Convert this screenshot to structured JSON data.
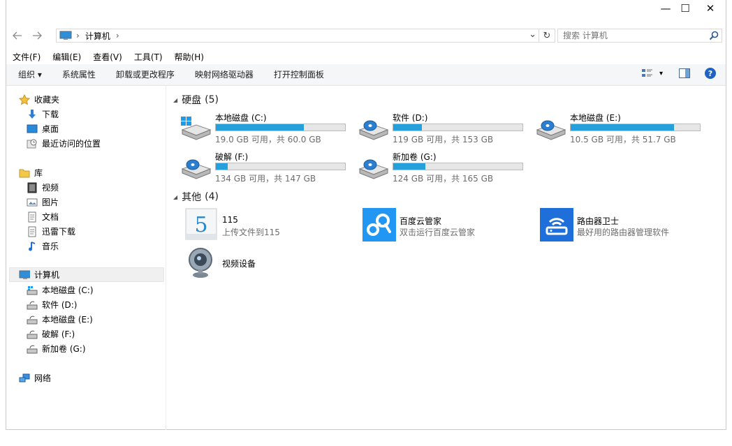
{
  "window": {
    "minimize": "—",
    "maximize": "☐",
    "close": "✕"
  },
  "address": {
    "path": "计算机",
    "sep1": "›",
    "sep2": "›",
    "dropdown": "⌄",
    "refresh": "↻"
  },
  "search": {
    "placeholder": "搜索 计算机"
  },
  "menubar": [
    "文件(F)",
    "编辑(E)",
    "查看(V)",
    "工具(T)",
    "帮助(H)"
  ],
  "toolbar": {
    "organize": "组织 ▾",
    "items": [
      "系统属性",
      "卸载或更改程序",
      "映射网络驱动器",
      "打开控制面板"
    ],
    "view_arrow": "▾",
    "help": "?"
  },
  "sidebar": {
    "favorites": {
      "label": "收藏夹",
      "items": [
        "下载",
        "桌面",
        "最近访问的位置"
      ]
    },
    "libraries": {
      "label": "库",
      "items": [
        "视频",
        "图片",
        "文档",
        "迅雷下载",
        "音乐"
      ]
    },
    "computer": {
      "label": "计算机",
      "items": [
        "本地磁盘 (C:)",
        "软件 (D:)",
        "本地磁盘 (E:)",
        "破解 (F:)",
        "新加卷 (G:)"
      ]
    },
    "network": {
      "label": "网络"
    }
  },
  "groups": {
    "drives": {
      "title": "硬盘",
      "count": "(5)"
    },
    "others": {
      "title": "其他",
      "count": "(4)"
    }
  },
  "drives": [
    {
      "name": "本地磁盘 (C:)",
      "info": "19.0 GB 可用，共 60.0 GB",
      "used": 0.68
    },
    {
      "name": "软件 (D:)",
      "info": "119 GB 可用，共 153 GB",
      "used": 0.22
    },
    {
      "name": "本地磁盘 (E:)",
      "info": "10.5 GB 可用，共 51.7 GB",
      "used": 0.8
    },
    {
      "name": "破解 (F:)",
      "info": "134 GB 可用，共 147 GB",
      "used": 0.09
    },
    {
      "name": "新加卷 (G:)",
      "info": "124 GB 可用，共 165 GB",
      "used": 0.25
    }
  ],
  "others": [
    {
      "name": "115",
      "sub": "上传文件到115",
      "icon_text": "5"
    },
    {
      "name": "百度云管家",
      "sub": "双击运行百度云管家"
    },
    {
      "name": "路由器卫士",
      "sub": "最好用的路由器管理软件"
    },
    {
      "name": "视频设备",
      "sub": ""
    }
  ],
  "colors": {
    "accent": "#26a0da",
    "baidu": "#2196f3",
    "router": "#1e6fd9"
  }
}
